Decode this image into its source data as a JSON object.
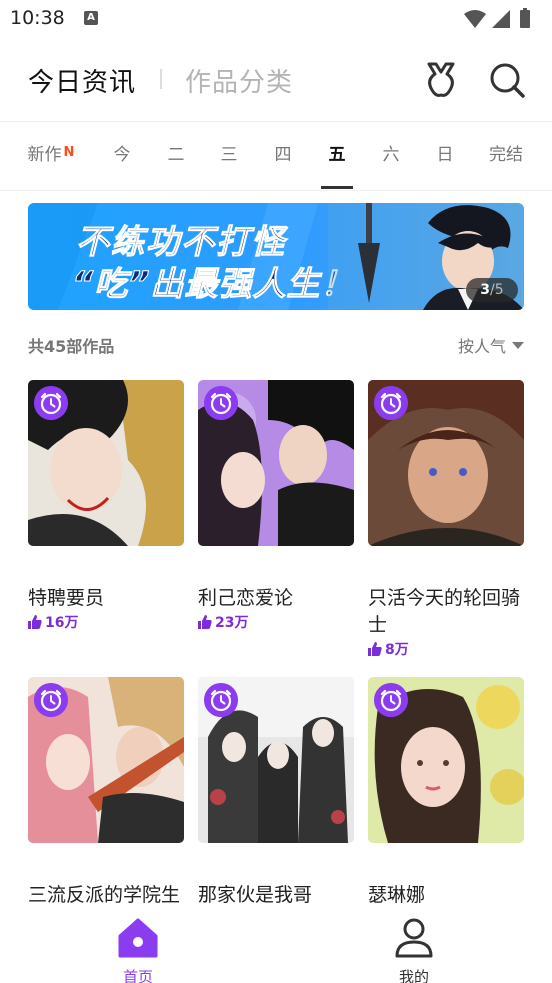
{
  "status_bar": {
    "time": "10:38",
    "notification_glyph": "A",
    "icons": [
      "wifi-icon",
      "cellular-icon",
      "battery-icon"
    ]
  },
  "header": {
    "tab_active": "今日资讯",
    "tab_inactive": "作品分类",
    "icons": [
      "badge-icon",
      "search-icon"
    ]
  },
  "day_tabs": {
    "items": [
      {
        "label": "新作",
        "mark": "N"
      },
      {
        "label": "今"
      },
      {
        "label": "二"
      },
      {
        "label": "三"
      },
      {
        "label": "四"
      },
      {
        "label": "五"
      },
      {
        "label": "六"
      },
      {
        "label": "日"
      },
      {
        "label": "完结"
      }
    ],
    "selected": "五"
  },
  "banner": {
    "line1": "不练功不打怪",
    "line2": "“吃”出最强人生！",
    "pager_current": "3",
    "pager_separator": "/",
    "pager_total": "5"
  },
  "list": {
    "count_label": "共45部作品",
    "sort_label": "按人气"
  },
  "works": [
    {
      "title": "特聘要员",
      "likes": "16万",
      "badge": "alarm-clock-icon"
    },
    {
      "title": "利己恋爱论",
      "likes": "23万",
      "badge": "alarm-clock-icon"
    },
    {
      "title": "只活今天的轮回骑士",
      "likes": "8万",
      "badge": "alarm-clock-icon"
    },
    {
      "title": "三流反派的学院生",
      "likes": "",
      "badge": "alarm-clock-icon"
    },
    {
      "title": "那家伙是我哥",
      "likes": "",
      "badge": "alarm-clock-icon"
    },
    {
      "title": "瑟琳娜",
      "likes": "",
      "badge": "alarm-clock-icon"
    }
  ],
  "bottom_nav": {
    "home_label": "首页",
    "me_label": "我的",
    "active": "首页"
  },
  "colors": {
    "accent": "#8c3cf0",
    "likes": "#7b2cdb",
    "new_mark": "#ff4d1a",
    "banner_blue": "#1ea3ff"
  }
}
